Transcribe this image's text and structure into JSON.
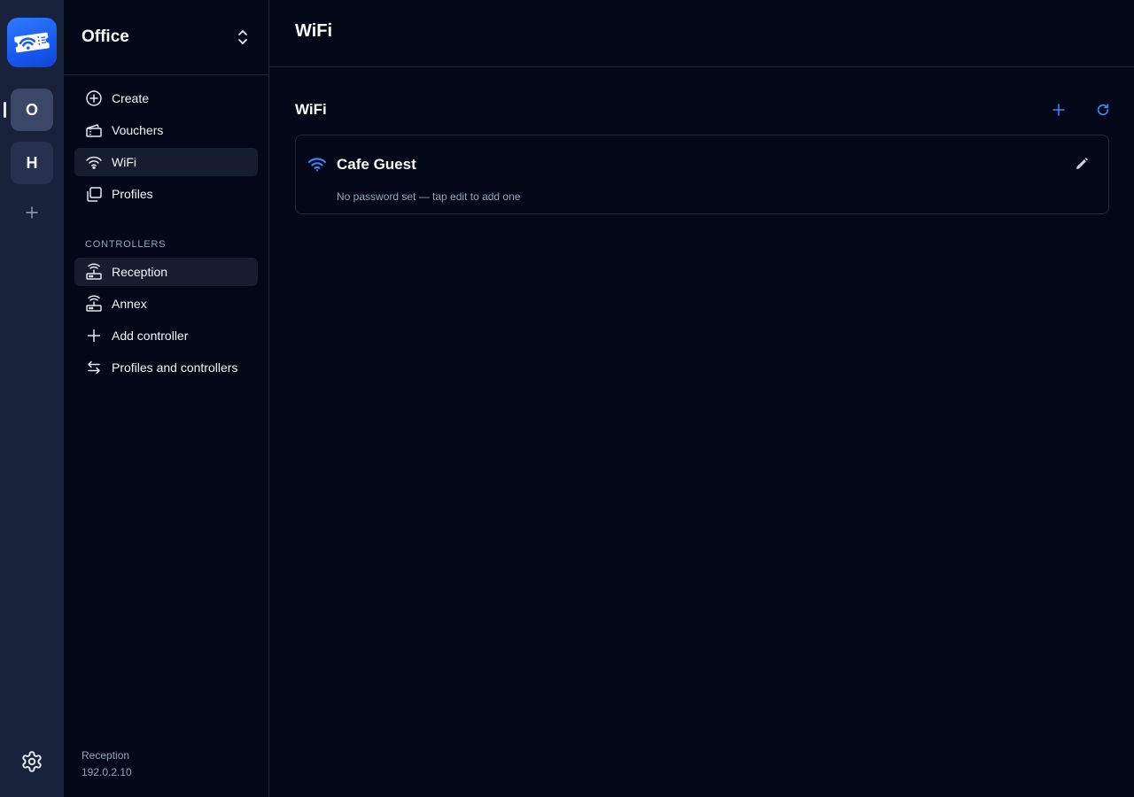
{
  "rail": {
    "workspaces": [
      {
        "initial": "O",
        "active": true
      },
      {
        "initial": "H",
        "active": false
      }
    ]
  },
  "sidebar": {
    "org_name": "Office",
    "nav": [
      {
        "label": "Create",
        "icon": "plus-circle-icon"
      },
      {
        "label": "Vouchers",
        "icon": "ticket-icon"
      },
      {
        "label": "WiFi",
        "icon": "wifi-icon",
        "active": true
      },
      {
        "label": "Profiles",
        "icon": "profiles-icon"
      }
    ],
    "controllers_label": "CONTROLLERS",
    "controllers": [
      {
        "label": "Reception",
        "icon": "router-icon",
        "active": true
      },
      {
        "label": "Annex",
        "icon": "router-icon"
      },
      {
        "label": "Add controller",
        "icon": "plus-icon"
      },
      {
        "label": "Profiles and controllers",
        "icon": "swap-arrows-icon"
      }
    ],
    "footer": {
      "controller_name": "Reception",
      "ip": "192.0.2.10"
    }
  },
  "main": {
    "page_title": "WiFi",
    "section_title": "WiFi",
    "networks": [
      {
        "ssid": "Cafe Guest",
        "subtitle": "No password set — tap edit to add one"
      }
    ]
  },
  "colors": {
    "accent": "#3b82f6",
    "background": "#020817",
    "rail": "#18223a",
    "border": "#1e293b",
    "muted_text": "#94a3b8"
  }
}
